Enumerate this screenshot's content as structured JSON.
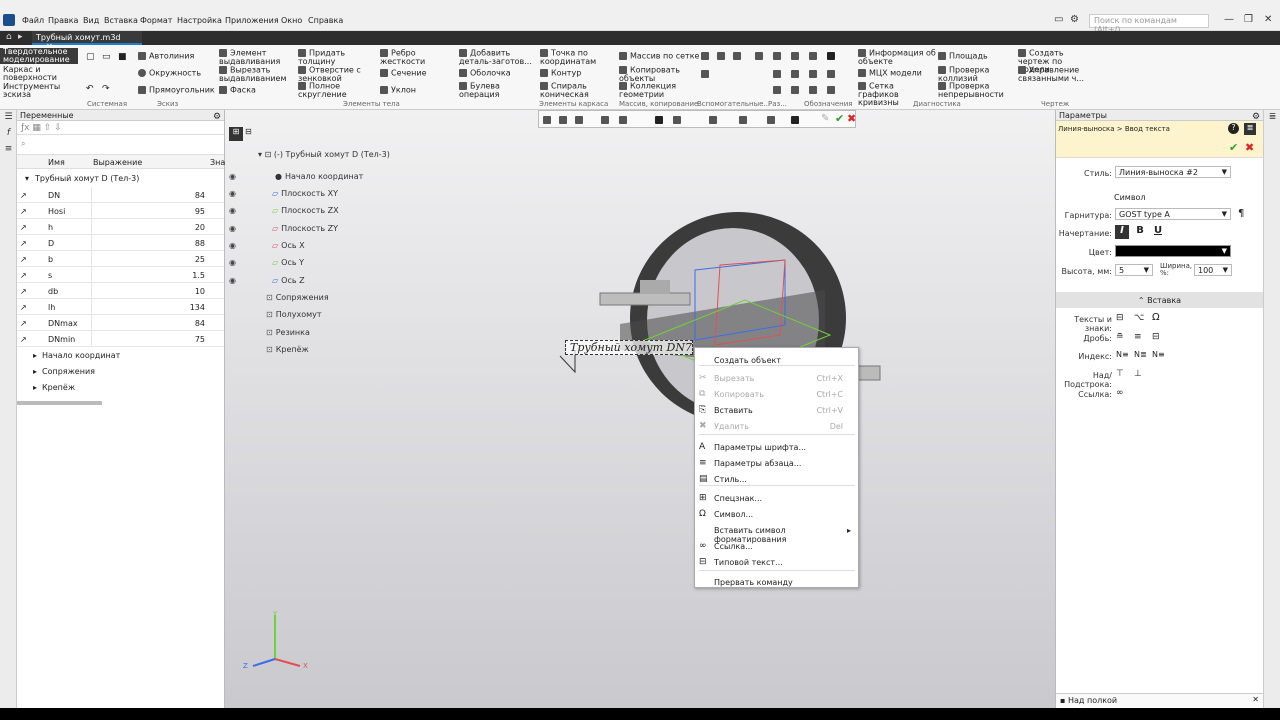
{
  "menu": {
    "items": [
      "Файл",
      "Правка",
      "Вид",
      "Вставка",
      "Формат",
      "Настройка",
      "Приложения",
      "Окно",
      "Справка"
    ],
    "search_placeholder": "Поиск по командам (Alt+/)"
  },
  "doc_tab": {
    "title": "Трубный хомут.m3d",
    "close": "✕"
  },
  "ribbon": {
    "modes": [
      "Твердотельное моделирование",
      "Каркас и поверхности",
      "Инструменты эскиза"
    ],
    "system_label": "Системная",
    "sketch": {
      "label": "Эскиз",
      "items": [
        "Автолиния",
        "Окружность",
        "Прямоугольник"
      ]
    },
    "body": {
      "label": "Элементы тела",
      "items": [
        "Элемент выдавливания",
        "Вырезать выдавливанием",
        "Фаска",
        "Придать толщину",
        "Отверстие с зенковкой",
        "Полное скругление",
        "Ребро жесткости",
        "Сечение",
        "Уклон",
        "Добавить деталь-заготов...",
        "Оболочка",
        "Булева операция"
      ]
    },
    "frame": {
      "label": "Элементы каркаса",
      "items": [
        "Точка по координатам",
        "Контур",
        "Спираль коническая"
      ]
    },
    "array": {
      "label": "Массив, копирование",
      "items": [
        "Массив по сетке",
        "Копировать объекты",
        "Коллекция геометрии"
      ]
    },
    "aux_label": "Вспомогательные...",
    "sizes_label": "Раз...",
    "notation_label": "Обозначения",
    "diag": {
      "label": "Диагностика",
      "items": [
        "Информация об объекте",
        "МЦХ модели",
        "Сетка графиков кривизны",
        "Площадь",
        "Проверка коллизий",
        "Проверка непрерывности"
      ]
    },
    "drawing": {
      "label": "Чертеж",
      "items": [
        "Создать чертеж по модели",
        "Управление связанными ч..."
      ]
    }
  },
  "variables": {
    "title": "Переменные",
    "cols": [
      "Имя",
      "Выражение",
      "Зна"
    ],
    "group": "Трубный хомут D (Тел-3)",
    "rows": [
      {
        "name": "DN",
        "value": "84"
      },
      {
        "name": "Hosi",
        "value": "95"
      },
      {
        "name": "h",
        "value": "20"
      },
      {
        "name": "D",
        "value": "88"
      },
      {
        "name": "b",
        "value": "25"
      },
      {
        "name": "s",
        "value": "1.5"
      },
      {
        "name": "db",
        "value": "10"
      },
      {
        "name": "lh",
        "value": "134"
      },
      {
        "name": "DNmax",
        "value": "84"
      },
      {
        "name": "DNmin",
        "value": "75"
      }
    ],
    "subgroups": [
      "Начало координат",
      "Сопряжения",
      "Крепёж"
    ]
  },
  "tree": {
    "root": "(-) Трубный хомут D (Тел-3)",
    "items": [
      "Начало координат",
      "Плоскость XY",
      "Плоскость ZX",
      "Плоскость ZY",
      "Ось X",
      "Ось Y",
      "Ось Z",
      "Сопряжения",
      "Полухомут",
      "Резинка",
      "Крепёж"
    ]
  },
  "leader_text": "Трубный хомут DN75...",
  "axes": {
    "x": "X",
    "y": "Y",
    "z": "Z"
  },
  "context_menu": [
    {
      "label": "Создать объект",
      "enabled": true,
      "shortcut": ""
    },
    {
      "label": "Вырезать",
      "enabled": false,
      "shortcut": "Ctrl+X"
    },
    {
      "label": "Копировать",
      "enabled": false,
      "shortcut": "Ctrl+C"
    },
    {
      "label": "Вставить",
      "enabled": true,
      "shortcut": "Ctrl+V"
    },
    {
      "label": "Удалить",
      "enabled": false,
      "shortcut": "Del"
    },
    {
      "label": "Параметры шрифта...",
      "enabled": true,
      "shortcut": ""
    },
    {
      "label": "Параметры абзаца...",
      "enabled": true,
      "shortcut": ""
    },
    {
      "label": "Стиль...",
      "enabled": true,
      "shortcut": ""
    },
    {
      "label": "Спецзнак...",
      "enabled": true,
      "shortcut": ""
    },
    {
      "label": "Символ...",
      "enabled": true,
      "shortcut": ""
    },
    {
      "label": "Вставить символ форматирования",
      "enabled": true,
      "shortcut": ""
    },
    {
      "label": "Ссылка...",
      "enabled": true,
      "shortcut": ""
    },
    {
      "label": "Типовой текст...",
      "enabled": true,
      "shortcut": ""
    },
    {
      "label": "Прервать команду",
      "enabled": true,
      "shortcut": ""
    }
  ],
  "params": {
    "title": "Параметры",
    "breadcrumb": "Линия-выноска > Ввод текста",
    "style_label": "Стиль:",
    "style_value": "Линия-выноска #2",
    "symbol_header": "Символ",
    "font_label": "Гарнитура:",
    "font_value": "GOST type A",
    "face_label": "Начертание:",
    "italic": "I",
    "bold": "B",
    "underline": "U",
    "color_label": "Цвет:",
    "color_value": "#000000",
    "height_label": "Высота, мм:",
    "height_value": "5",
    "width_label": "Ширина, %:",
    "width_value": "100",
    "insert_header": "Вставка",
    "texts_label": "Тексты и знаки:",
    "fraction_label": "Дробь:",
    "index_label": "Индекс:",
    "over_label": "Над/Подстрока:",
    "link_label": "Ссылка:",
    "footer": "Над полкой"
  }
}
